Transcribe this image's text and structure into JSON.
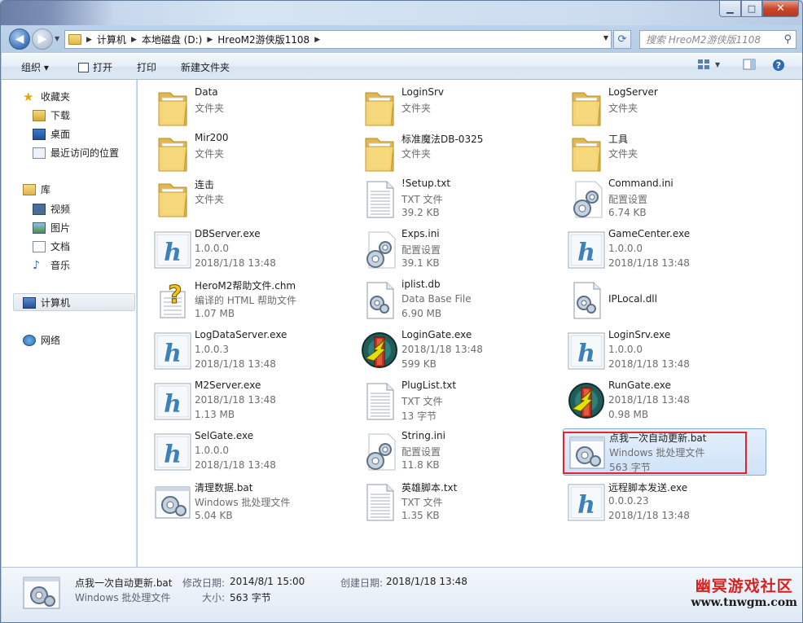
{
  "window": {
    "controls": {
      "minimize": "▁",
      "maximize": "□",
      "close": "✕"
    }
  },
  "address": {
    "crumbs": [
      "计算机",
      "本地磁盘 (D:)",
      "HreoM2游侠版1108"
    ],
    "search_placeholder": "搜索 HreoM2游侠版1108"
  },
  "toolbar": {
    "organize": "组织 ▾",
    "open": "打开",
    "print": "打印",
    "new_folder": "新建文件夹"
  },
  "nav": {
    "favorites": "收藏夹",
    "downloads": "下载",
    "desktop": "桌面",
    "recent": "最近访问的位置",
    "libraries": "库",
    "videos": "视频",
    "pictures": "图片",
    "documents": "文档",
    "music": "音乐",
    "computer": "计算机",
    "network": "网络"
  },
  "files": [
    {
      "name": "Data",
      "l2": "文件夹",
      "l3": "",
      "icon": "folder-icon"
    },
    {
      "name": "LoginSrv",
      "l2": "文件夹",
      "l3": "",
      "icon": "folder-icon"
    },
    {
      "name": "LogServer",
      "l2": "文件夹",
      "l3": "",
      "icon": "folder-icon"
    },
    {
      "name": "Mir200",
      "l2": "文件夹",
      "l3": "",
      "icon": "folder-icon"
    },
    {
      "name": "标准魔法DB-0325",
      "l2": "文件夹",
      "l3": "",
      "icon": "folder-icon"
    },
    {
      "name": "工具",
      "l2": "文件夹",
      "l3": "",
      "icon": "folder-icon"
    },
    {
      "name": "连击",
      "l2": "文件夹",
      "l3": "",
      "icon": "folder-icon"
    },
    {
      "name": "!Setup.txt",
      "l2": "TXT 文件",
      "l3": "39.2 KB",
      "icon": "text-file-icon"
    },
    {
      "name": "Command.ini",
      "l2": "配置设置",
      "l3": "6.74 KB",
      "icon": "config-gear-icon"
    },
    {
      "name": "DBServer.exe",
      "l2": "1.0.0.0",
      "l3": "2018/1/18 13:48",
      "icon": "app-h-icon"
    },
    {
      "name": "Exps.ini",
      "l2": "配置设置",
      "l3": "39.1 KB",
      "icon": "config-gear-icon"
    },
    {
      "name": "GameCenter.exe",
      "l2": "1.0.0.0",
      "l3": "2018/1/18 13:48",
      "icon": "app-h-icon"
    },
    {
      "name": "HeroM2帮助文件.chm",
      "l2": "编译的 HTML 帮助文件",
      "l3": "1.07 MB",
      "icon": "help-file-icon"
    },
    {
      "name": "iplist.db",
      "l2": "Data Base File",
      "l3": "6.90 MB",
      "icon": "system-file-icon"
    },
    {
      "name": "IPLocal.dll",
      "l2": "",
      "l3": "",
      "icon": "system-file-icon"
    },
    {
      "name": "LogDataServer.exe",
      "l2": "1.0.0.3",
      "l3": "2018/1/18 13:48",
      "icon": "app-h-icon"
    },
    {
      "name": "LoginGate.exe",
      "l2": "2018/1/18 13:48",
      "l3": "599 KB",
      "icon": "gate-icon"
    },
    {
      "name": "LoginSrv.exe",
      "l2": "1.0.0.0",
      "l3": "2018/1/18 13:48",
      "icon": "app-h-icon"
    },
    {
      "name": "M2Server.exe",
      "l2": "2018/1/18 13:48",
      "l3": "1.13 MB",
      "icon": "app-h-icon"
    },
    {
      "name": "PlugList.txt",
      "l2": "TXT 文件",
      "l3": "13 字节",
      "icon": "text-file-icon"
    },
    {
      "name": "RunGate.exe",
      "l2": "2018/1/18 13:48",
      "l3": "0.98 MB",
      "icon": "gate-icon"
    },
    {
      "name": "SelGate.exe",
      "l2": "1.0.0.0",
      "l3": "2018/1/18 13:48",
      "icon": "app-h-icon"
    },
    {
      "name": "String.ini",
      "l2": "配置设置",
      "l3": "11.8 KB",
      "icon": "config-gear-icon"
    },
    {
      "name": "点我一次自动更新.bat",
      "l2": "Windows 批处理文件",
      "l3": "563 字节",
      "icon": "batch-file-icon"
    },
    {
      "name": "清理数据.bat",
      "l2": "Windows 批处理文件",
      "l3": "5.04 KB",
      "icon": "batch-file-icon"
    },
    {
      "name": "英雄脚本.txt",
      "l2": "TXT 文件",
      "l3": "1.35 KB",
      "icon": "text-file-icon"
    },
    {
      "name": "远程脚本发送.exe",
      "l2": "0.0.0.23",
      "l3": "2018/1/18 13:48",
      "icon": "app-h-icon"
    }
  ],
  "details": {
    "name": "点我一次自动更新.bat",
    "type": "Windows 批处理文件",
    "modified_label": "修改日期:",
    "modified": "2014/8/1 15:00",
    "created_label": "创建日期:",
    "created": "2018/1/18 13:48",
    "size_label": "大小:",
    "size": "563 字节"
  },
  "watermark": {
    "line1": "幽冥游戏社区",
    "line2": "www.tnwgm.com"
  }
}
